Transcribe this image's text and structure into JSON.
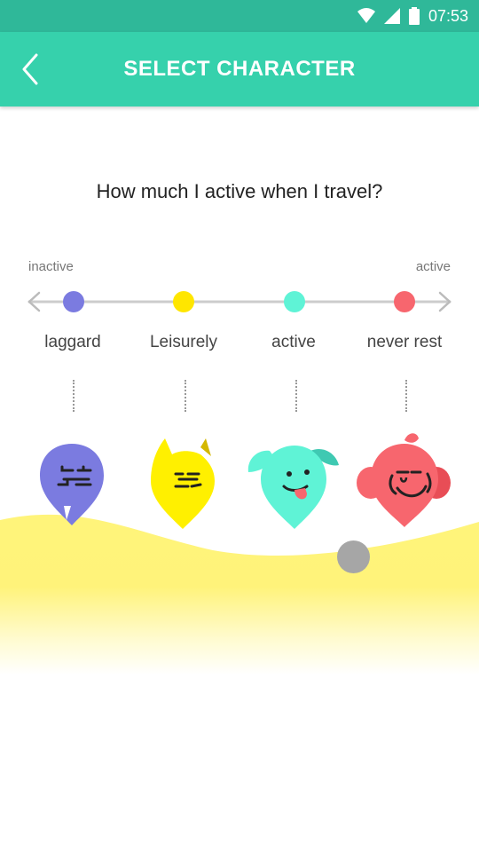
{
  "status_bar": {
    "time": "07:53",
    "icons": [
      "wifi-icon",
      "signal-icon",
      "battery-icon"
    ]
  },
  "header": {
    "title": "SELECT CHARACTER",
    "back_icon": "chevron-left-icon"
  },
  "question": "How much I active when I travel?",
  "scale": {
    "start_label": "inactive",
    "end_label": "active"
  },
  "levels": [
    {
      "label": "laggard",
      "color": "#7b7be0"
    },
    {
      "label": "Leisurely",
      "color": "#ffe600"
    },
    {
      "label": "active",
      "color": "#5ff3d6"
    },
    {
      "label": "never rest",
      "color": "#f7666e"
    }
  ],
  "colors": {
    "accent": "#36d1ac",
    "status_bar": "#2fb899",
    "sand": "#fff477"
  }
}
